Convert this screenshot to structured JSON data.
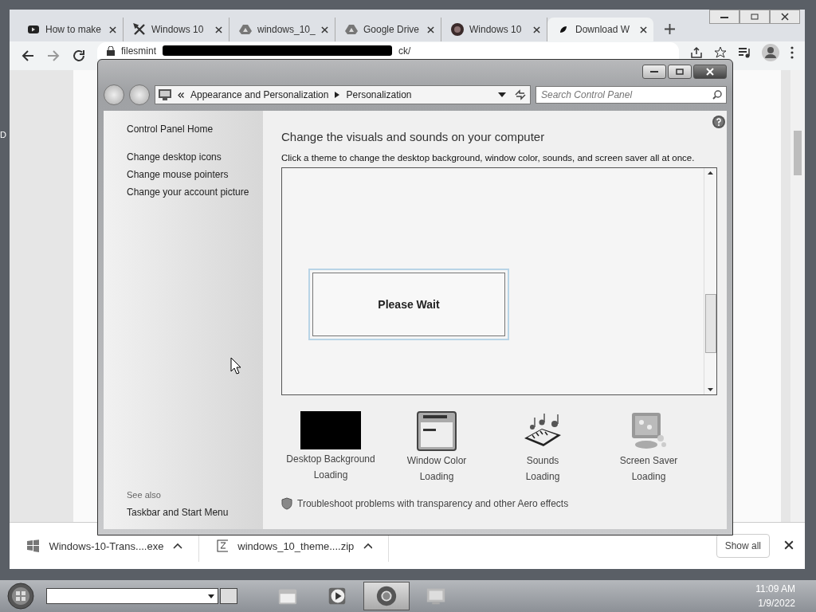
{
  "desktop": {
    "icon_label": "D"
  },
  "browser": {
    "tabs": [
      {
        "title": "How to make",
        "kind": "video",
        "selected": false
      },
      {
        "title": "Windows 10",
        "kind": "tools",
        "selected": false
      },
      {
        "title": "windows_10_",
        "kind": "drive",
        "selected": false
      },
      {
        "title": "Google Drive",
        "kind": "drive",
        "selected": false
      },
      {
        "title": "Windows 10",
        "kind": "round",
        "selected": false
      },
      {
        "title": "Download W",
        "kind": "leaf",
        "selected": true
      }
    ],
    "address": {
      "url_start": "filesmint",
      "url_end": "ck/"
    },
    "downloads": [
      {
        "file": "Windows-10-Trans....exe",
        "kind": "exe"
      },
      {
        "file": "windows_10_theme....zip",
        "kind": "zip"
      }
    ],
    "show_all": "Show all"
  },
  "control_panel": {
    "breadcrumb": [
      "Appearance and Personalization",
      "Personalization"
    ],
    "search_placeholder": "Search Control Panel",
    "sidebar": {
      "links": [
        "Control Panel Home",
        "Change desktop icons",
        "Change mouse pointers",
        "Change your account picture"
      ],
      "see_also_heading": "See also",
      "see_also": [
        "Taskbar and Start Menu"
      ]
    },
    "heading": "Change the visuals and sounds on your computer",
    "description": "Click a theme to change the desktop background, window color, sounds, and screen saver all at once.",
    "dialog": {
      "message": "Please Wait"
    },
    "items": [
      {
        "label": "Desktop Background",
        "status": "Loading",
        "kind": "background"
      },
      {
        "label": "Window Color",
        "status": "Loading",
        "kind": "color"
      },
      {
        "label": "Sounds",
        "status": "Loading",
        "kind": "sounds"
      },
      {
        "label": "Screen Saver",
        "status": "Loading",
        "kind": "saver"
      }
    ],
    "troubleshoot": "Troubleshoot problems with transparency and other Aero effects"
  },
  "taskbar": {
    "buttons": [
      {
        "kind": "explorer",
        "selected": false
      },
      {
        "kind": "media",
        "selected": false
      },
      {
        "kind": "chrome",
        "selected": true
      },
      {
        "kind": "control-panel",
        "selected": false
      }
    ],
    "time": "11:09 AM",
    "date": "1/9/2022"
  }
}
